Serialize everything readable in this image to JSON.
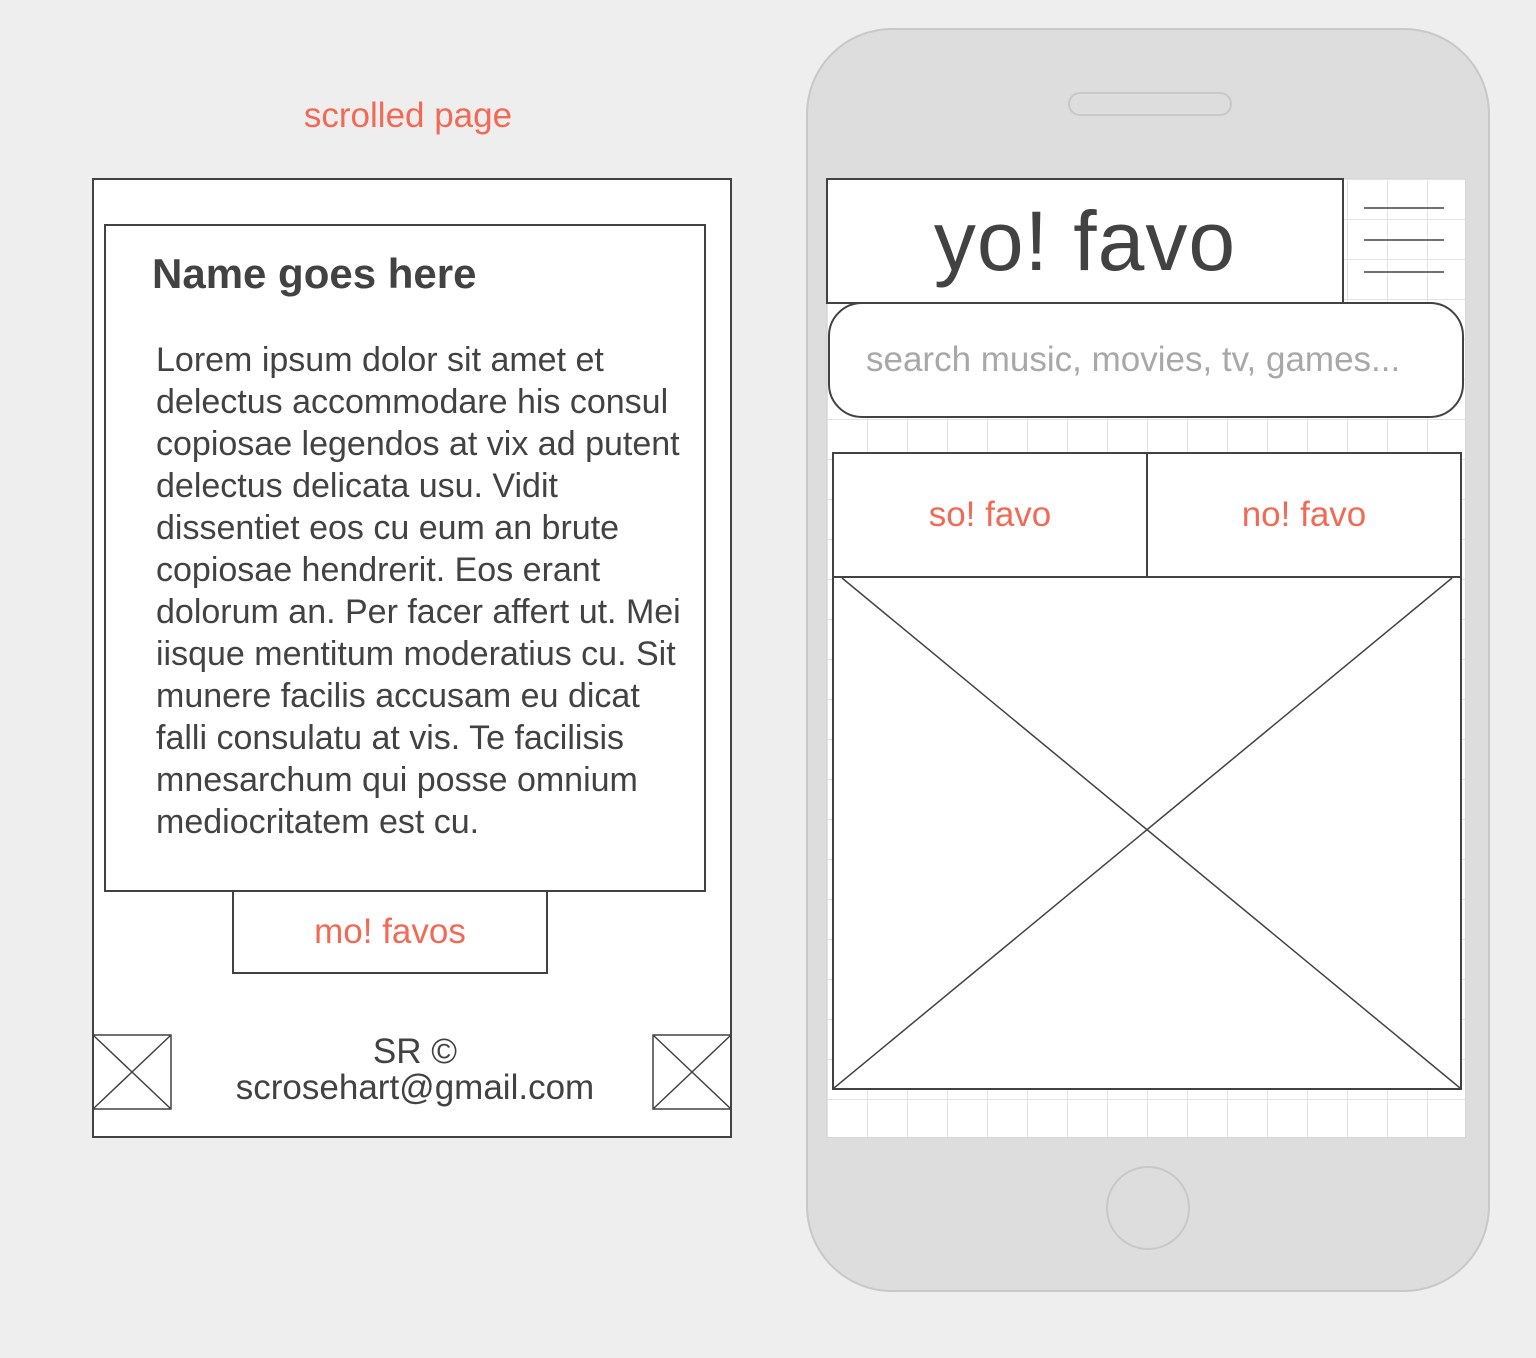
{
  "caption": "scrolled page",
  "scrolled_page": {
    "card_title": "Name goes here",
    "card_body": "Lorem ipsum dolor sit amet et delectus accommodare his consul copiosae legendos at vix ad putent delectus delicata usu. Vidit dissentiet eos cu eum an brute copiosae hendrerit. Eos erant dolorum an. Per facer affert ut. Mei iisque mentitum moderatius cu. Sit munere facilis accusam eu dicat falli consulatu at vis. Te facilisis mnesarchum qui posse omnium mediocritatem est cu.",
    "more_button": "mo! favos",
    "footer_line1": "SR ©",
    "footer_line2": "scrosehart@gmail.com"
  },
  "phone": {
    "app_title": "yo! favo",
    "search_placeholder": "search music, movies, tv, games...",
    "tabs": [
      {
        "label": "so! favo"
      },
      {
        "label": "no! favo"
      }
    ]
  },
  "colors": {
    "accent": "#f26a56",
    "ink": "#424242",
    "background": "#eeeeee",
    "phone_body": "#dddddd"
  },
  "icons": [
    "hamburger-menu-icon",
    "image-placeholder-icon"
  ]
}
